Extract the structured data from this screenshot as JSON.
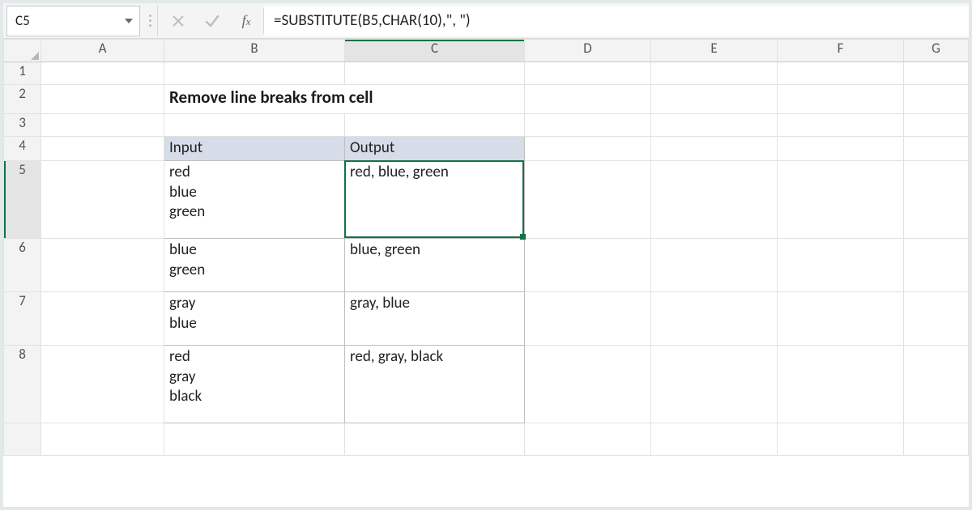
{
  "name_box": "C5",
  "formula": "=SUBSTITUTE(B5,CHAR(10),\", \")",
  "columns": [
    "A",
    "B",
    "C",
    "D",
    "E",
    "F",
    "G"
  ],
  "active_col_index": 2,
  "row_labels": [
    "1",
    "2",
    "3",
    "4",
    "5",
    "6",
    "7",
    "8"
  ],
  "active_row_index": 4,
  "title": "Remove line breaks from cell",
  "table": {
    "headers": {
      "input": "Input",
      "output": "Output"
    },
    "rows": [
      {
        "input": "red\nblue\ngreen",
        "output": "red, blue, green"
      },
      {
        "input": "blue\ngreen",
        "output": "blue, green"
      },
      {
        "input": "gray\nblue",
        "output": "gray, blue"
      },
      {
        "input": "red\ngray\nblack",
        "output": "red, gray, black"
      }
    ]
  },
  "active_cell": {
    "ref": "C5"
  }
}
